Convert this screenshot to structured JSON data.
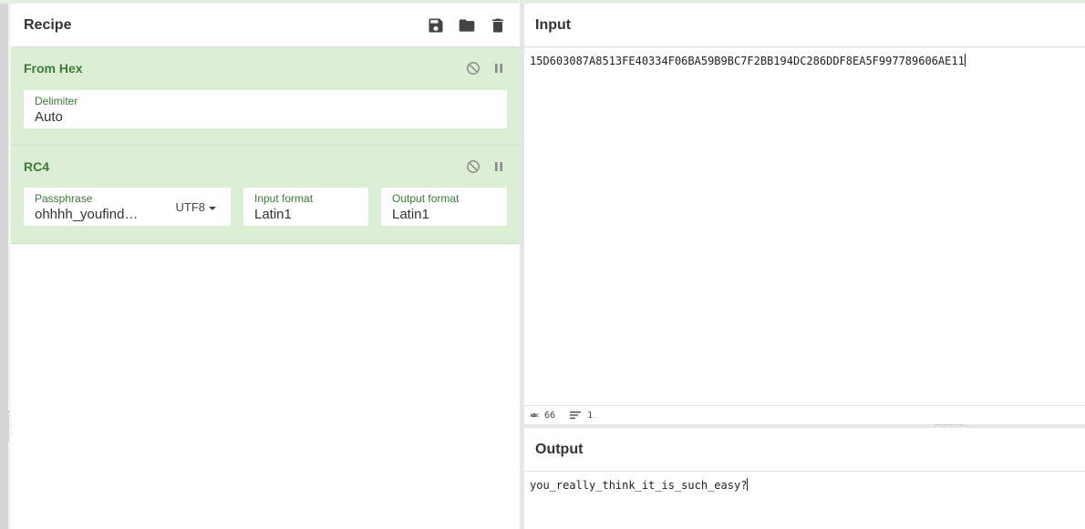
{
  "recipe": {
    "title": "Recipe",
    "icons": [
      "save-icon",
      "folder-icon",
      "trash-icon"
    ],
    "operations": [
      {
        "name": "From Hex",
        "fields": [
          {
            "label": "Delimiter",
            "value": "Auto"
          }
        ]
      },
      {
        "name": "RC4",
        "fields": [
          {
            "label": "Passphrase",
            "value": "ohhhh_youfind…",
            "encoding": "UTF8"
          },
          {
            "label": "Input format",
            "value": "Latin1"
          },
          {
            "label": "Output format",
            "value": "Latin1"
          }
        ]
      }
    ]
  },
  "input": {
    "title": "Input",
    "text": "15D603087A8513FE40334F06BA59B9BC7F2BB194DC286DDF8EA5F997789606AE11",
    "status": {
      "abc_label": "ᴀʙᴄ",
      "length": "66",
      "lines": "1"
    }
  },
  "output": {
    "title": "Output",
    "text": "you_really_think_it_is_such_easy?"
  },
  "colors": {
    "operation_bg": "#dcefd6",
    "operation_text": "#3c7a35",
    "disable_icon": "#8a8a8a"
  }
}
